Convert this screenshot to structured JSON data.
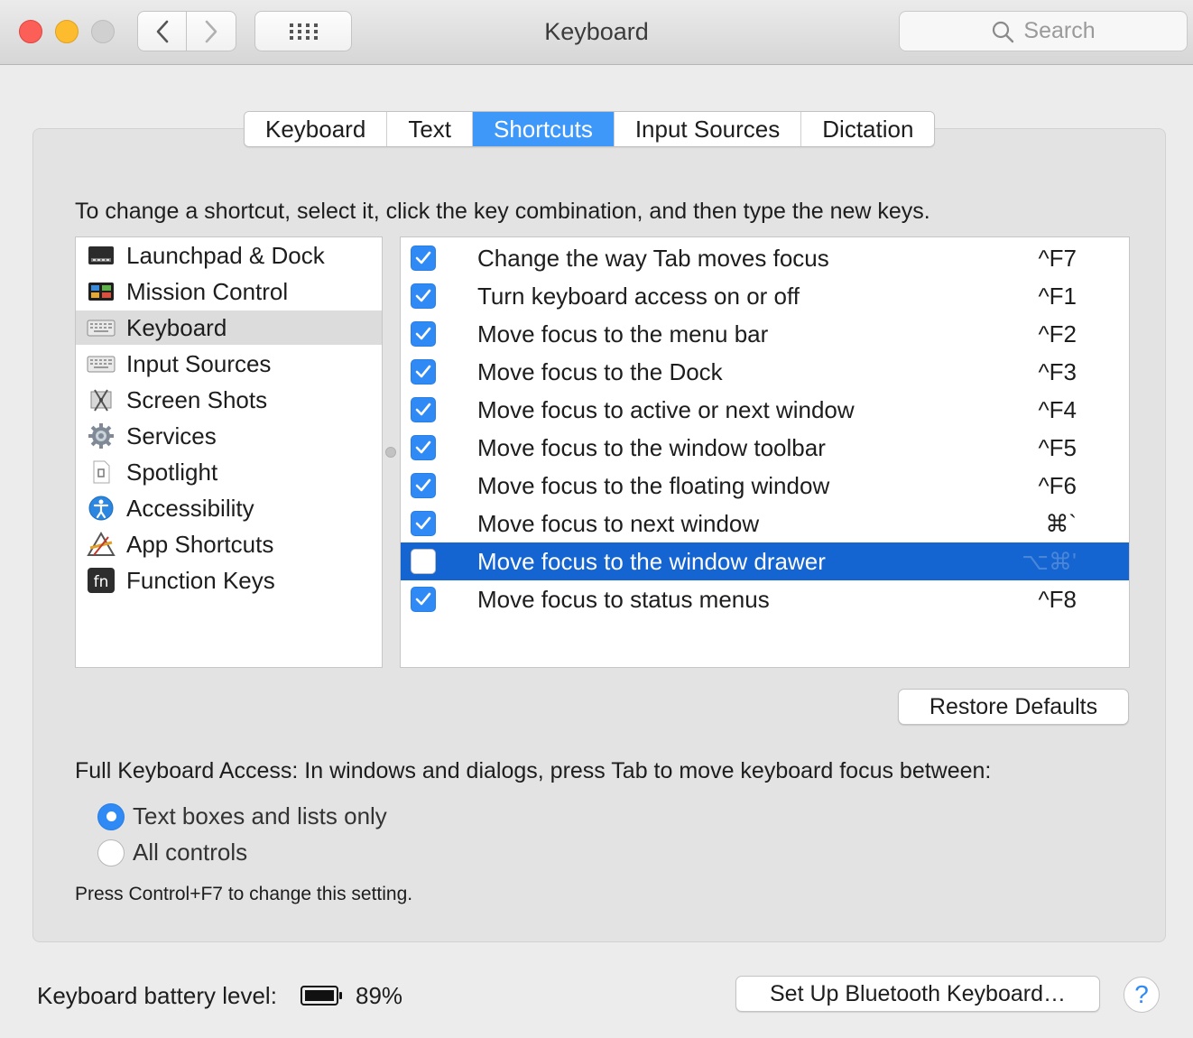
{
  "window": {
    "title": "Keyboard",
    "search_placeholder": "Search"
  },
  "tabs": [
    {
      "label": "Keyboard",
      "active": false
    },
    {
      "label": "Text",
      "active": false
    },
    {
      "label": "Shortcuts",
      "active": true
    },
    {
      "label": "Input Sources",
      "active": false
    },
    {
      "label": "Dictation",
      "active": false
    }
  ],
  "instruction": "To change a shortcut, select it, click the key combination, and then type the new keys.",
  "categories": [
    {
      "label": "Launchpad & Dock",
      "icon": "launchpad-dock-icon"
    },
    {
      "label": "Mission Control",
      "icon": "mission-control-icon"
    },
    {
      "label": "Keyboard",
      "icon": "keyboard-icon",
      "selected": true
    },
    {
      "label": "Input Sources",
      "icon": "input-sources-icon"
    },
    {
      "label": "Screen Shots",
      "icon": "screen-shots-icon"
    },
    {
      "label": "Services",
      "icon": "services-gear-icon"
    },
    {
      "label": "Spotlight",
      "icon": "spotlight-icon"
    },
    {
      "label": "Accessibility",
      "icon": "accessibility-icon"
    },
    {
      "label": "App Shortcuts",
      "icon": "app-shortcuts-icon"
    },
    {
      "label": "Function Keys",
      "icon": "fn-key-icon"
    }
  ],
  "shortcuts": [
    {
      "label": "Change the way Tab moves focus",
      "key": "^F7",
      "checked": true
    },
    {
      "label": "Turn keyboard access on or off",
      "key": "^F1",
      "checked": true
    },
    {
      "label": "Move focus to the menu bar",
      "key": "^F2",
      "checked": true
    },
    {
      "label": "Move focus to the Dock",
      "key": "^F3",
      "checked": true
    },
    {
      "label": "Move focus to active or next window",
      "key": "^F4",
      "checked": true
    },
    {
      "label": "Move focus to the window toolbar",
      "key": "^F5",
      "checked": true
    },
    {
      "label": "Move focus to the floating window",
      "key": "^F6",
      "checked": true
    },
    {
      "label": "Move focus to next window",
      "key": "⌘`",
      "checked": true
    },
    {
      "label": "Move focus to the window drawer",
      "key": "⌥⌘'",
      "checked": false,
      "selected": true
    },
    {
      "label": "Move focus to status menus",
      "key": "^F8",
      "checked": true
    }
  ],
  "restore_defaults": "Restore Defaults",
  "full_keyboard_access": {
    "text": "Full Keyboard Access: In windows and dialogs, press Tab to move keyboard focus between:",
    "options": [
      {
        "label": "Text boxes and lists only",
        "selected": true
      },
      {
        "label": "All controls",
        "selected": false
      }
    ],
    "hint": "Press Control+F7 to change this setting."
  },
  "footer": {
    "battery_label": "Keyboard battery level:",
    "battery_level": "89%",
    "bluetooth_button": "Set Up Bluetooth Keyboard…",
    "help": "?"
  },
  "colors": {
    "accent": "#3d98f9",
    "selection": "#1464d2",
    "close": "#fc5f57",
    "minimize": "#fdbc2e"
  }
}
